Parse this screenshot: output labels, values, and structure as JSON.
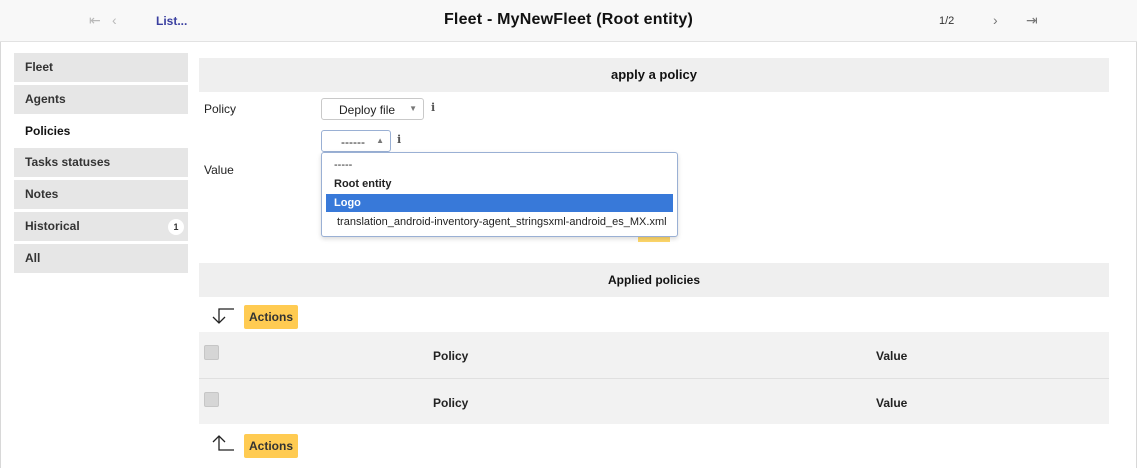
{
  "header": {
    "list_link": "List...",
    "title": "Fleet - MyNewFleet (Root entity)",
    "pager": "1/2"
  },
  "sidebar": {
    "items": [
      {
        "label": "Fleet"
      },
      {
        "label": "Agents"
      },
      {
        "label": "Policies"
      },
      {
        "label": "Tasks statuses"
      },
      {
        "label": "Notes"
      },
      {
        "label": "Historical",
        "badge": "1"
      },
      {
        "label": "All"
      }
    ]
  },
  "form": {
    "heading": "apply a policy",
    "policy_label": "Policy",
    "policy_value": "Deploy file",
    "value_label": "Value",
    "value_selected": "------",
    "dropdown_options": [
      {
        "label": "-----",
        "type": "option"
      },
      {
        "label": "Root entity",
        "type": "group"
      },
      {
        "label": "Logo",
        "type": "option",
        "selected": true
      },
      {
        "label": "translation_android-inventory-agent_stringsxml-android_es_MX.xml",
        "type": "option"
      }
    ]
  },
  "applied": {
    "heading": "Applied policies",
    "actions_label": "Actions",
    "columns": [
      "Policy",
      "Value"
    ]
  },
  "colors": {
    "accent": "#ffcb52",
    "selection": "#3879d9",
    "link": "#3a3fa0"
  }
}
